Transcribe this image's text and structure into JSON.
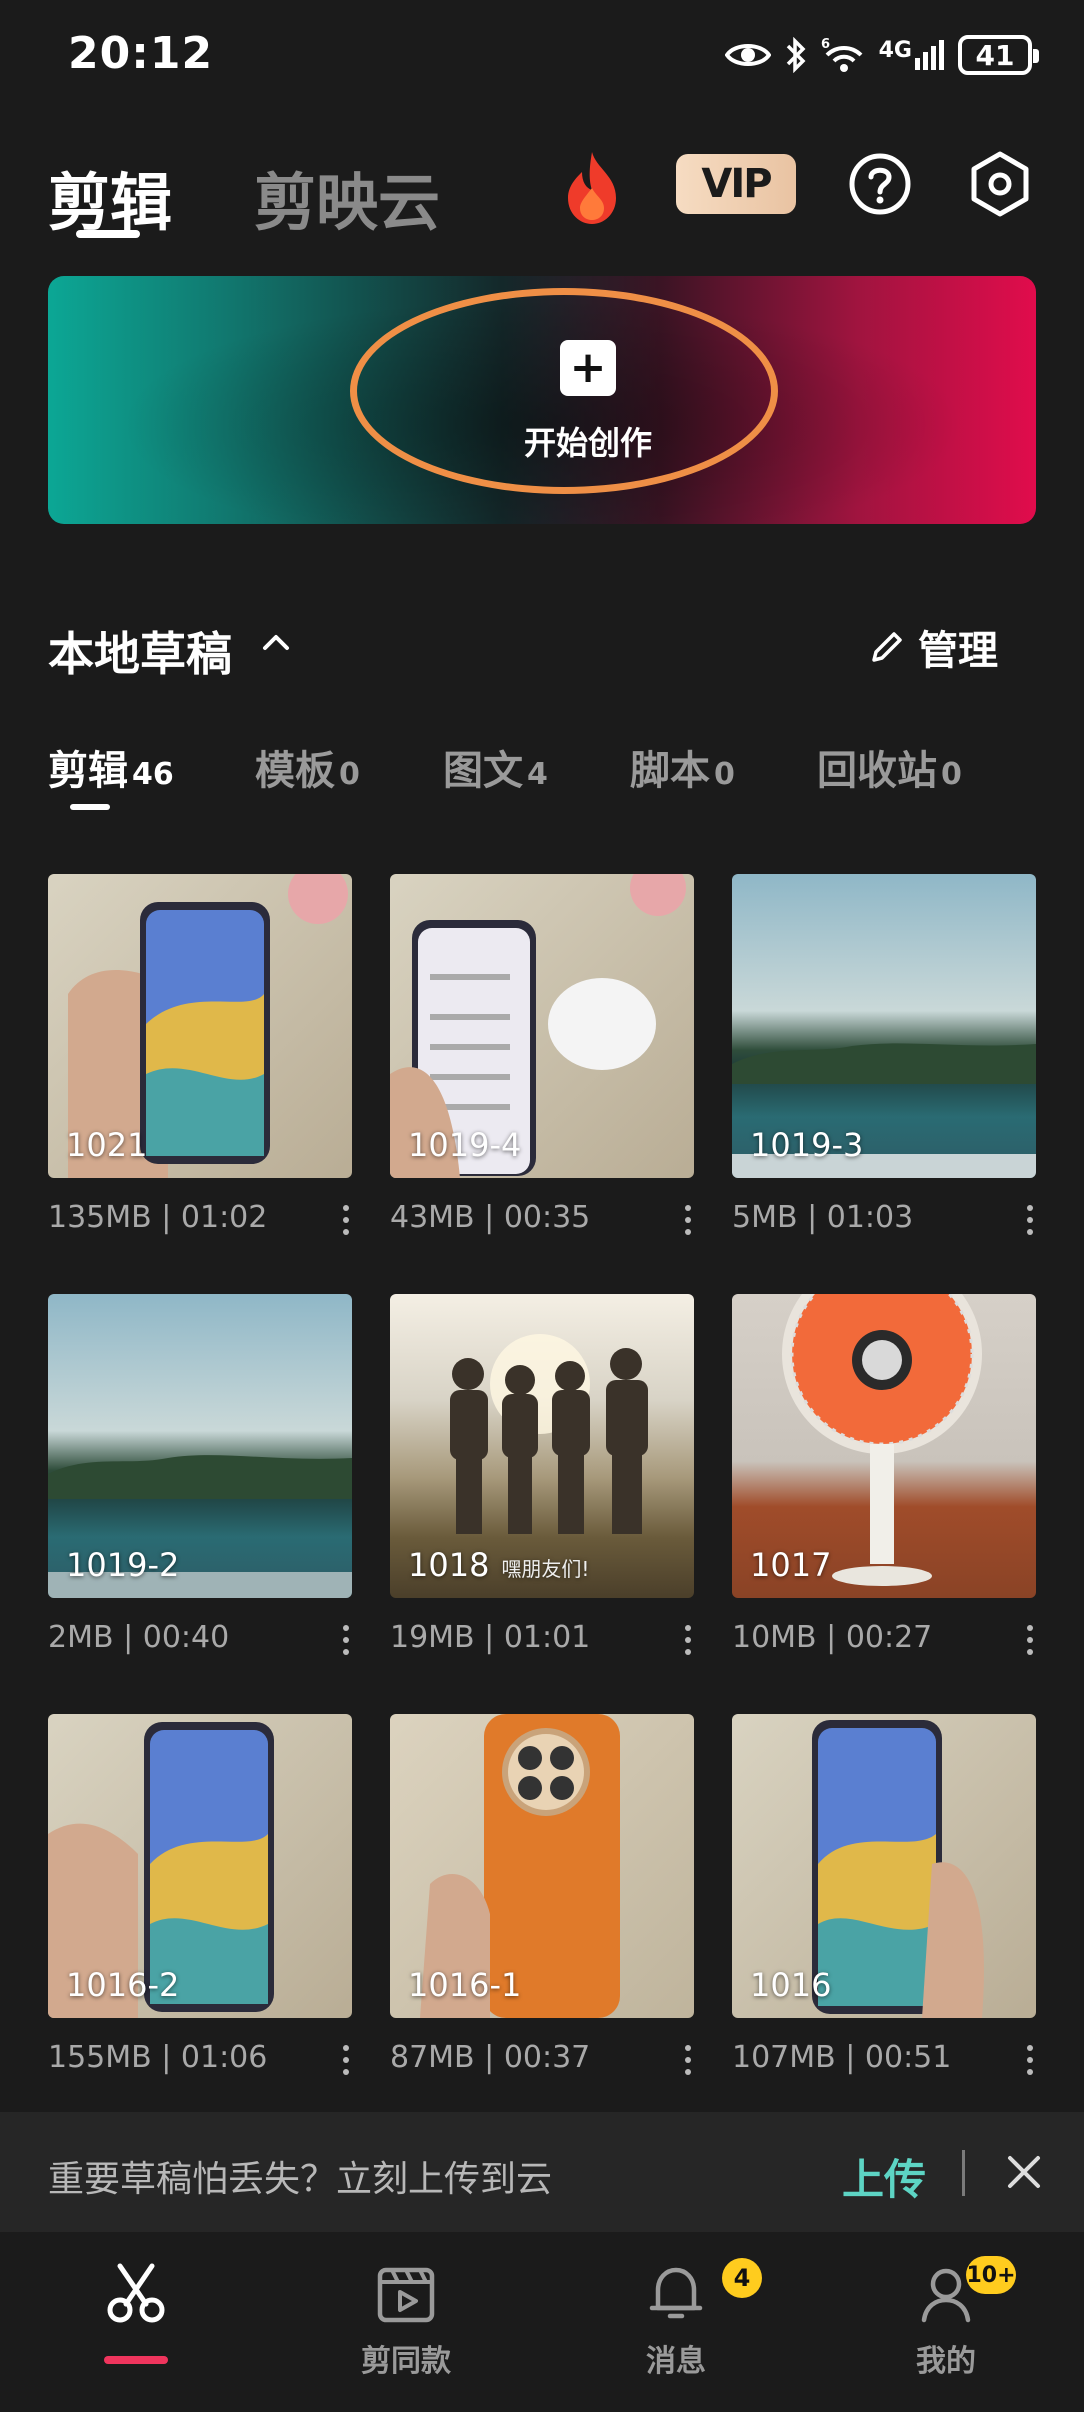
{
  "status_bar": {
    "time": "20:12",
    "battery": "41",
    "network_label": "4G",
    "sim_label": "6"
  },
  "header": {
    "tab_active": "剪辑",
    "tab_inactive": "剪映云",
    "vip_label": "VIP",
    "icons": [
      "fire-icon",
      "help-icon",
      "settings-icon"
    ]
  },
  "banner": {
    "create_label": "开始创作",
    "plus_symbol": "+",
    "highlight_color": "#ef8f46"
  },
  "drafts": {
    "title": "本地草稿",
    "manage_label": "管理",
    "tabs": [
      {
        "label": "剪辑",
        "count": "46"
      },
      {
        "label": "模板",
        "count": "0"
      },
      {
        "label": "图文",
        "count": "4"
      },
      {
        "label": "脚本",
        "count": "0"
      },
      {
        "label": "回收站",
        "count": "0"
      }
    ],
    "items": [
      {
        "name": "1021",
        "meta": "135MB | 01:02"
      },
      {
        "name": "1019-4",
        "meta": "43MB | 00:35"
      },
      {
        "name": "1019-3",
        "meta": "5MB | 01:03"
      },
      {
        "name": "1019-2",
        "meta": "2MB | 00:40"
      },
      {
        "name": "1018",
        "caption": "嘿朋友们!",
        "meta": "19MB | 01:01"
      },
      {
        "name": "1017",
        "meta": "10MB | 00:27"
      },
      {
        "name": "1016-2",
        "meta": "155MB | 01:06"
      },
      {
        "name": "1016-1",
        "meta": "87MB | 00:37"
      },
      {
        "name": "1016",
        "meta": "107MB | 00:51"
      }
    ]
  },
  "cloud_prompt": {
    "text": "重要草稿怕丢失？立刻上传到云",
    "upload_label": "上传",
    "accent_color": "#5dd4c4"
  },
  "bottom_nav": {
    "items": [
      {
        "label": "",
        "icon": "scissors-icon"
      },
      {
        "label": "剪同款",
        "icon": "template-icon"
      },
      {
        "label": "消息",
        "icon": "bell-icon",
        "badge": "4"
      },
      {
        "label": "我的",
        "icon": "user-icon",
        "badge": "10+"
      }
    ],
    "active_color": "#f0355d"
  }
}
